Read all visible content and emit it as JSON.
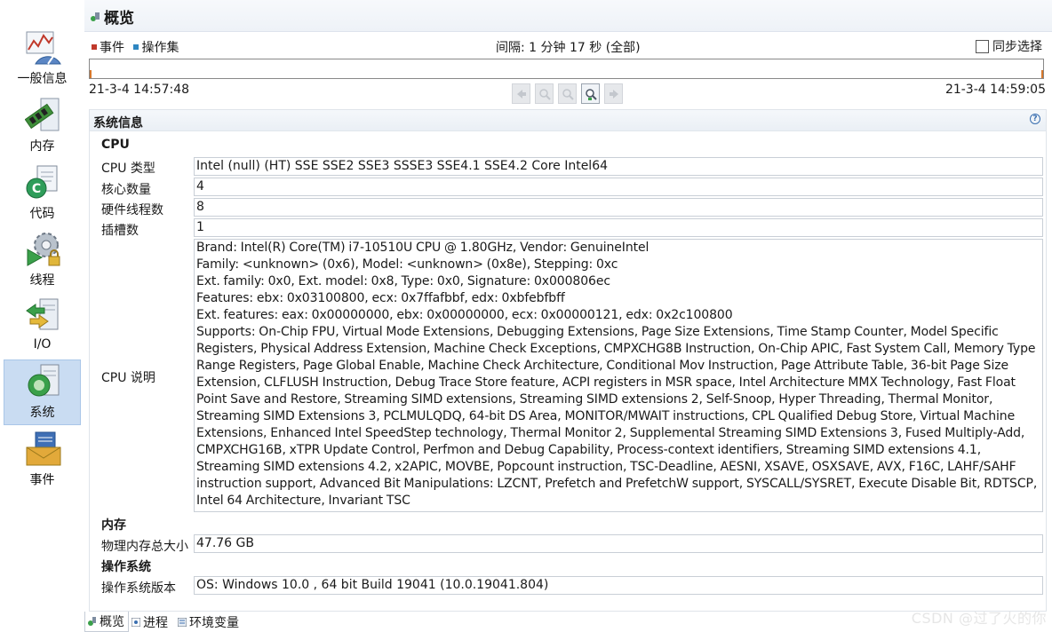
{
  "sidebar": {
    "items": [
      {
        "label": "一般信息",
        "icon": "chart-gauge-icon"
      },
      {
        "label": "内存",
        "icon": "memory-chip-icon"
      },
      {
        "label": "代码",
        "icon": "code-document-icon"
      },
      {
        "label": "线程",
        "icon": "thread-gear-icon"
      },
      {
        "label": "I/O",
        "icon": "io-transfer-icon"
      },
      {
        "label": "系统",
        "icon": "system-server-icon"
      },
      {
        "label": "事件",
        "icon": "event-envelope-icon"
      }
    ],
    "active_index": 5
  },
  "header": {
    "title": "概览"
  },
  "timeline": {
    "legend": [
      {
        "label": "事件",
        "color": "#c0392b"
      },
      {
        "label": "操作集",
        "color": "#2e86c1"
      }
    ],
    "interval": "间隔: 1 分钟 17 秒 (全部)",
    "sync_label": "同步选择",
    "start_time": "21-3-4 14:57:48",
    "end_time": "21-3-4 14:59:05"
  },
  "system_info": {
    "title": "系统信息",
    "help": "?",
    "cpu": {
      "section": "CPU",
      "type_label": "CPU 类型",
      "type_value": "Intel (null) (HT) SSE SSE2 SSE3 SSSE3 SSE4.1 SSE4.2 Core Intel64",
      "cores_label": "核心数量",
      "cores_value": "4",
      "threads_label": "硬件线程数",
      "threads_value": "8",
      "sockets_label": "插槽数",
      "sockets_value": "1",
      "desc_label": "CPU 说明",
      "desc_lines": [
        "Brand: Intel(R) Core(TM) i7-10510U CPU @ 1.80GHz, Vendor: GenuineIntel",
        "Family: <unknown> (0x6), Model: <unknown> (0x8e), Stepping: 0xc",
        "Ext. family: 0x0, Ext. model: 0x8, Type: 0x0, Signature: 0x000806ec",
        "Features: ebx: 0x03100800, ecx: 0x7ffafbbf, edx: 0xbfebfbff",
        "Ext. features: eax: 0x00000000, ebx: 0x00000000, ecx: 0x00000121, edx: 0x2c100800",
        "Supports: On-Chip FPU, Virtual Mode Extensions, Debugging Extensions, Page Size Extensions, Time Stamp Counter, Model Specific",
        "Registers, Physical Address Extension, Machine Check Exceptions, CMPXCHG8B Instruction, On-Chip APIC, Fast System Call, Memory Type",
        "Range Registers, Page Global Enable, Machine Check Architecture, Conditional Mov Instruction, Page Attribute Table, 36-bit Page Size",
        "Extension, CLFLUSH Instruction, Debug Trace Store feature, ACPI registers in MSR space, Intel Architecture MMX Technology, Fast Float",
        "Point Save and Restore, Streaming SIMD extensions, Streaming SIMD extensions 2, Self-Snoop, Hyper Threading, Thermal Monitor,",
        "Streaming SIMD Extensions 3, PCLMULQDQ, 64-bit DS Area, MONITOR/MWAIT instructions, CPL Qualified Debug Store, Virtual Machine",
        "Extensions, Enhanced Intel SpeedStep technology, Thermal Monitor 2, Supplemental Streaming SIMD Extensions 3, Fused Multiply-Add,",
        "CMPXCHG16B, xTPR Update Control, Perfmon and Debug Capability, Process-context identifiers, Streaming SIMD extensions 4.1,",
        "Streaming SIMD extensions 4.2, x2APIC, MOVBE, Popcount instruction, TSC-Deadline, AESNI, XSAVE, OSXSAVE, AVX, F16C, LAHF/SAHF",
        "instruction support, Advanced Bit Manipulations: LZCNT, Prefetch and PrefetchW support, SYSCALL/SYSRET, Execute Disable Bit, RDTSCP,",
        "Intel 64 Architecture, Invariant TSC"
      ]
    },
    "memory": {
      "section": "内存",
      "total_label": "物理内存总大小",
      "total_value": "47.76 GB"
    },
    "os": {
      "section": "操作系统",
      "version_label": "操作系统版本",
      "version_value": "OS: Windows 10.0 , 64 bit Build 19041 (10.0.19041.804)"
    }
  },
  "bottom_tabs": [
    {
      "label": "概览",
      "icon": "overview-icon"
    },
    {
      "label": "进程",
      "icon": "process-icon"
    },
    {
      "label": "环境变量",
      "icon": "environment-icon"
    }
  ],
  "watermark": "CSDN @过了火的你"
}
